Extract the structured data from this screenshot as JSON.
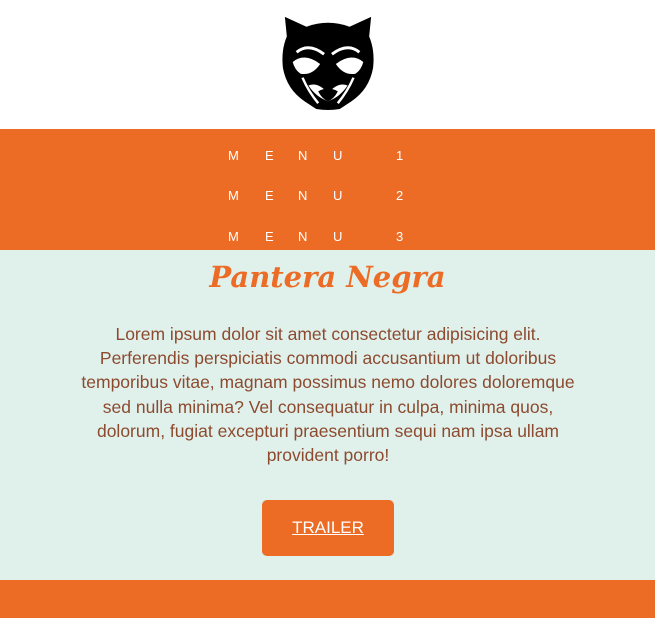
{
  "header": {
    "logo_icon": "panther-head-logo-icon"
  },
  "nav": {
    "items": [
      {
        "label": "MENU 1"
      },
      {
        "label": "MENU 2"
      },
      {
        "label": "MENU 3"
      }
    ]
  },
  "main": {
    "title": "Pantera Negra",
    "description": "Lorem ipsum dolor sit amet consectetur adipisicing elit. Perferendis perspiciatis commodi accusantium ut doloribus temporibus vitae, magnam possimus nemo dolores doloremque sed nulla minima? Vel consequatur in culpa, minima quos, dolorum, fugiat excepturi praesentium sequi nam ipsa ullam provident porro!",
    "trailer_label": "TRAILER"
  },
  "colors": {
    "accent": "#ec6c26",
    "background": "#e0f1ec",
    "text": "#8c4a2f"
  }
}
